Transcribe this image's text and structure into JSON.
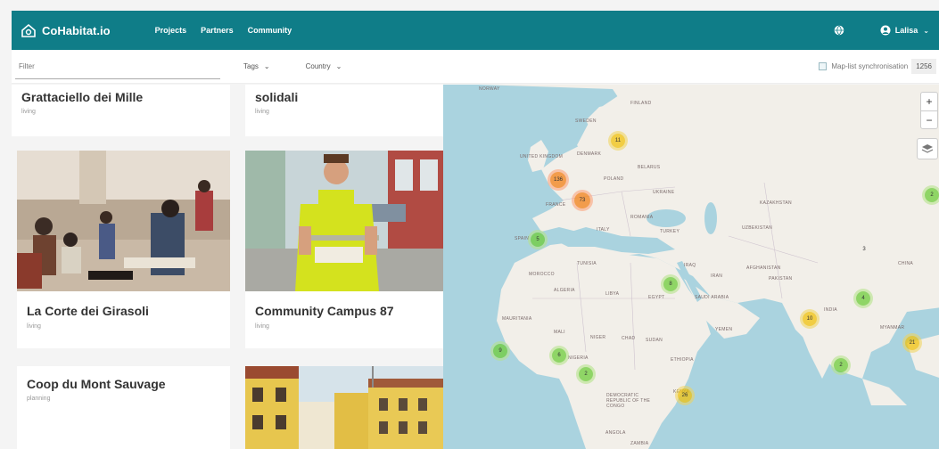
{
  "header": {
    "brand": "CoHabitat.io",
    "nav": [
      "Projects",
      "Partners",
      "Community"
    ],
    "user": "Lalisa"
  },
  "filters": {
    "filter_placeholder": "Filter",
    "tags_label": "Tags",
    "country_label": "Country",
    "sync_label": "Map-list synchronisation",
    "count": "1256"
  },
  "cards": [
    {
      "title": "Grattaciello dei Mille",
      "status": "living"
    },
    {
      "title": "solidali",
      "status": "living"
    },
    {
      "title": "La Corte dei Girasoli",
      "status": "living"
    },
    {
      "title": "Community Campus 87",
      "status": "living"
    },
    {
      "title": "Coop du Mont Sauvage",
      "status": "planning"
    },
    {
      "title": "",
      "status": ""
    }
  ],
  "map": {
    "zoom_in": "+",
    "zoom_out": "−",
    "clusters": [
      {
        "label": "11",
        "color": "yellow"
      },
      {
        "label": "136",
        "color": "orange"
      },
      {
        "label": "73",
        "color": "orange"
      },
      {
        "label": "5",
        "color": "green"
      },
      {
        "label": "2",
        "color": "green"
      },
      {
        "label": "8",
        "color": "green"
      },
      {
        "label": "4",
        "color": "green"
      },
      {
        "label": "9",
        "color": "green"
      },
      {
        "label": "6",
        "color": "green"
      },
      {
        "label": "2",
        "color": "green"
      },
      {
        "label": "10",
        "color": "yellow"
      },
      {
        "label": "26",
        "color": "yellow"
      },
      {
        "label": "2",
        "color": "green"
      },
      {
        "label": "21",
        "color": "yellow"
      },
      {
        "label": "3",
        "color": "green"
      }
    ],
    "labels": [
      "SWEDEN",
      "NORWAY",
      "FINLAND",
      "UNITED KINGDOM",
      "DENMARK",
      "BELARUS",
      "POLAND",
      "UKRAINE",
      "FRANCE",
      "ROMANIA",
      "KAZAKHSTAN",
      "SPAIN",
      "ITALY",
      "TURKEY",
      "UZBEKISTAN",
      "TUNISIA",
      "IRAQ",
      "IRAN",
      "AFGHANISTAN",
      "MOROCCO",
      "ALGERIA",
      "LIBYA",
      "EGYPT",
      "SAUDI ARABIA",
      "PAKISTAN",
      "INDIA",
      "MAURITANIA",
      "MALI",
      "NIGER",
      "CHAD",
      "SUDAN",
      "YEMEN",
      "NIGERIA",
      "ETHIOPIA",
      "DEMOCRATIC REPUBLIC OF THE CONGO",
      "KENYA",
      "ANGOLA",
      "ZAMBIA",
      "CHINA",
      "MYANMAR"
    ]
  }
}
